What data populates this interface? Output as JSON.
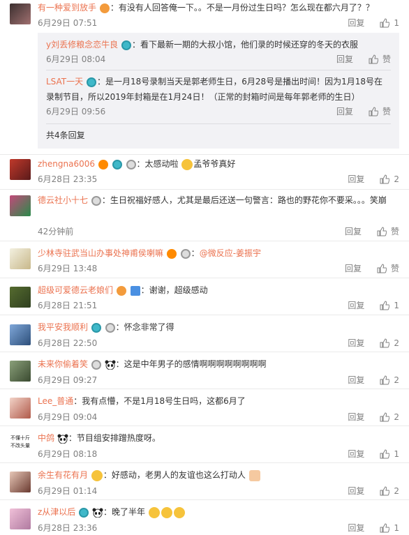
{
  "like_label": "赞",
  "reply_label": "回复",
  "comments": [
    {
      "user": "有一种爱到放手",
      "text": "：有没有人回答俺一下。。不是一月份过生日吗？怎么现在都六月了？？",
      "time": "6月29日 07:51",
      "likes": "1"
    },
    {
      "user": "zhengna6006",
      "text": "：太感动啦",
      "text2": "孟爷爷真好",
      "time": "6月28日 23:35",
      "likes": "2"
    },
    {
      "user": "德云社小十七",
      "text": "：生日祝福好感人，尤其是最后还送一句警言：路也的野花你不要采。。。笑崩",
      "time": "42分钟前",
      "likes": "赞"
    },
    {
      "user": "少林寺驻武当山办事处神甫侯喇嘛",
      "text": "：",
      "mention": "@微反应-姜振宇",
      "time": "6月29日 13:48",
      "likes": "赞"
    },
    {
      "user": "超级可爱德云老娘们",
      "text": "：谢谢，超级感动",
      "time": "6月28日 21:51",
      "likes": "1"
    },
    {
      "user": "我平安我顺利",
      "text": "：怀念非常了得",
      "time": "6月28日 22:50",
      "likes": "2"
    },
    {
      "user": "未来你偷着笑",
      "text": "：这是中年男子的感情啊啊啊啊啊啊啊啊",
      "time": "6月29日 09:27",
      "likes": "2"
    },
    {
      "user": "Lee_普通",
      "text": "：我有点懵，不是1月18号生日吗，这都6月了",
      "time": "6月29日 09:04",
      "likes": "2"
    },
    {
      "user": "中鸽",
      "text": "：节目组安排蹭热度呀。",
      "time": "6月29日 08:18",
      "likes": "1"
    },
    {
      "user": "余生有花有月",
      "text": "：好感动，老男人的友谊也这么打动人",
      "time": "6月29日 01:14",
      "likes": "2"
    },
    {
      "user": "z从津以后",
      "text": "：晚了半年",
      "time": "6月28日 23:36",
      "likes": "1"
    }
  ],
  "sub_replies": [
    {
      "user": "y刘丢修粮念恋牛良",
      "text": "：看下最新一期的大叔小馆，他们录的时候还穿的冬天的衣服",
      "time": "6月29日 08:04",
      "likes": "赞"
    },
    {
      "user": "LSAT一天",
      "text": "：是一月18号录制当天是郭老师生日，6月28号是播出时间！因为1月18号在录制节目，所以2019年封箱是在1月24日！（正常的封箱时间是每年郭老师的生日）",
      "time": "6月29日 09:56",
      "likes": "赞"
    }
  ],
  "more_replies": "共4条回复",
  "avatar_text": {
    "zhongge_line1": "不懂十斤",
    "zhongge_line2": "不改头量"
  }
}
